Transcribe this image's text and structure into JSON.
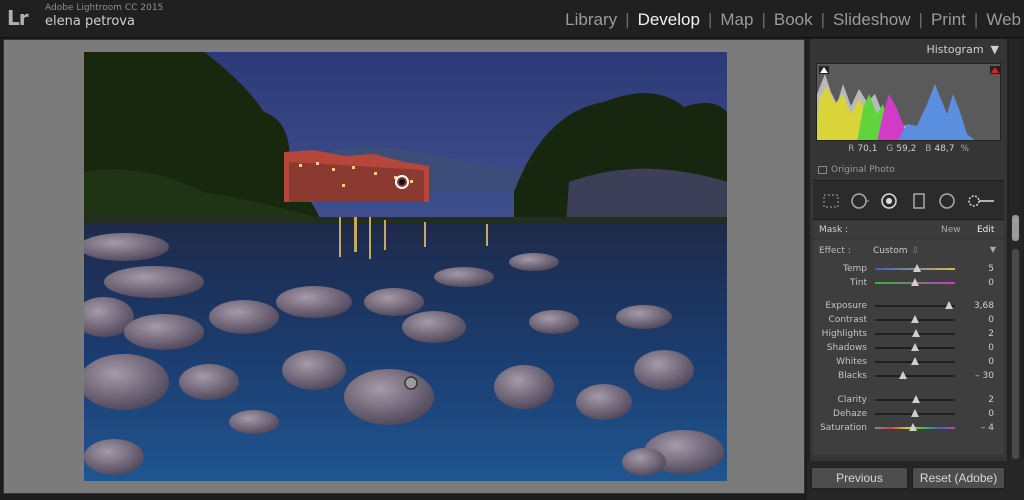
{
  "app": {
    "logo": "Lr",
    "name": "Adobe Lightroom CC 2015",
    "user": "elena petrova"
  },
  "modules": [
    {
      "label": "Library",
      "active": false
    },
    {
      "label": "Develop",
      "active": true
    },
    {
      "label": "Map",
      "active": false
    },
    {
      "label": "Book",
      "active": false
    },
    {
      "label": "Slideshow",
      "active": false
    },
    {
      "label": "Print",
      "active": false
    },
    {
      "label": "Web",
      "active": false
    }
  ],
  "histogram": {
    "title": "Histogram",
    "r_label": "R",
    "r_value": "70,1",
    "g_label": "G",
    "g_value": "59,2",
    "b_label": "B",
    "b_value": "48,7",
    "unit": "%",
    "original_photo": "Original Photo"
  },
  "mask": {
    "label": "Mask :",
    "new": "New",
    "edit": "Edit"
  },
  "effect": {
    "label": "Effect :",
    "value": "Custom",
    "caret": "▼"
  },
  "sliders": [
    {
      "label": "Temp",
      "value": "5",
      "pos": 0.53,
      "track": "temp"
    },
    {
      "label": "Tint",
      "value": "0",
      "pos": 0.5,
      "track": "tint"
    },
    {
      "label": "Exposure",
      "value": "3,68",
      "pos": 0.93,
      "track": "plain"
    },
    {
      "label": "Contrast",
      "value": "0",
      "pos": 0.5,
      "track": "plain"
    },
    {
      "label": "Highlights",
      "value": "2",
      "pos": 0.51,
      "track": "plain"
    },
    {
      "label": "Shadows",
      "value": "0",
      "pos": 0.5,
      "track": "plain"
    },
    {
      "label": "Whites",
      "value": "0",
      "pos": 0.5,
      "track": "plain"
    },
    {
      "label": "Blacks",
      "value": "– 30",
      "pos": 0.35,
      "track": "plain"
    },
    {
      "label": "Clarity",
      "value": "2",
      "pos": 0.51,
      "track": "plain"
    },
    {
      "label": "Dehaze",
      "value": "0",
      "pos": 0.5,
      "track": "plain"
    },
    {
      "label": "Saturation",
      "value": "– 4",
      "pos": 0.48,
      "track": "sat"
    }
  ],
  "buttons": {
    "previous": "Previous",
    "reset": "Reset (Adobe)"
  },
  "colors": {
    "accent_active": "#f1f1f1",
    "panel_bg": "#353535",
    "canvas_bg": "#7b7b7b"
  }
}
